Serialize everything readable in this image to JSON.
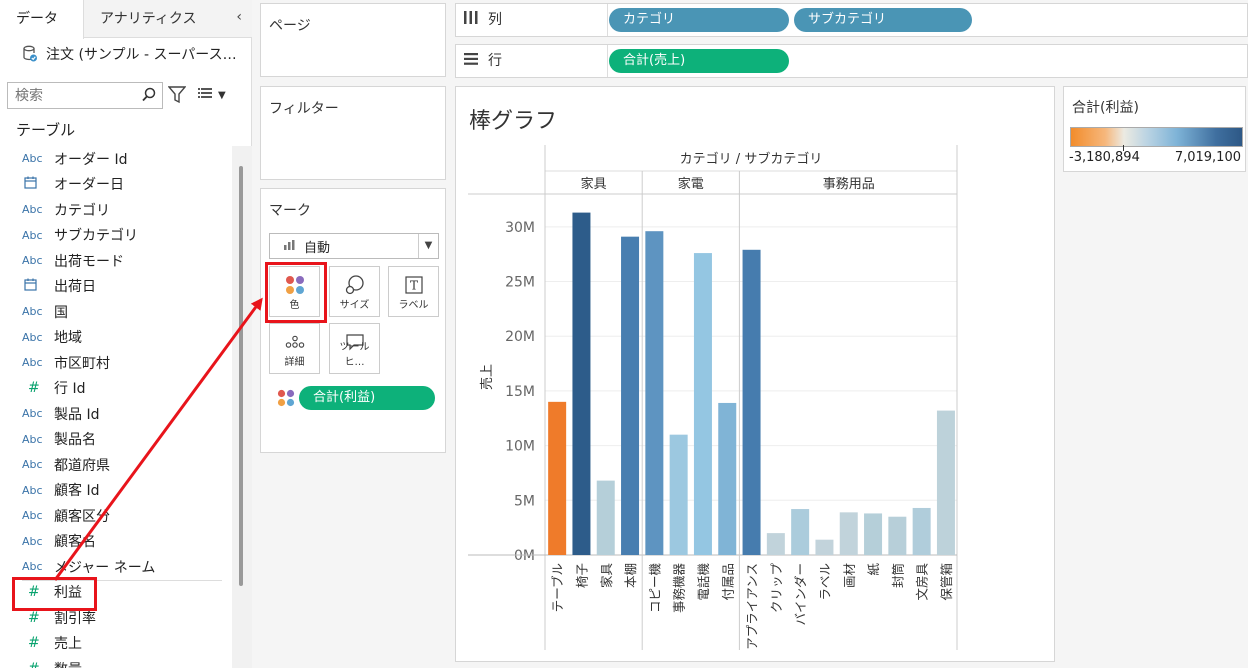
{
  "left_pane": {
    "tabs": [
      "データ",
      "アナリティクス"
    ],
    "collapse_icon": "‹",
    "datasource": "注文 (サンプル - スーパース…",
    "search_placeholder": "検索",
    "section_label": "テーブル",
    "fields": [
      {
        "type": "Abc",
        "name": "オーダー Id"
      },
      {
        "type": "date",
        "name": "オーダー日"
      },
      {
        "type": "Abc",
        "name": "カテゴリ"
      },
      {
        "type": "Abc",
        "name": "サブカテゴリ"
      },
      {
        "type": "Abc",
        "name": "出荷モード"
      },
      {
        "type": "date",
        "name": "出荷日"
      },
      {
        "type": "Abc",
        "name": "国"
      },
      {
        "type": "Abc",
        "name": "地域"
      },
      {
        "type": "Abc",
        "name": "市区町村"
      },
      {
        "type": "#",
        "name": "行 Id"
      },
      {
        "type": "Abc",
        "name": "製品 Id"
      },
      {
        "type": "Abc",
        "name": "製品名"
      },
      {
        "type": "Abc",
        "name": "都道府県"
      },
      {
        "type": "Abc",
        "name": "顧客 Id"
      },
      {
        "type": "Abc",
        "name": "顧客区分"
      },
      {
        "type": "Abc",
        "name": "顧客名"
      },
      {
        "type": "Abc",
        "name": "メジャー ネーム"
      },
      {
        "type": "#",
        "name": "利益"
      },
      {
        "type": "#",
        "name": "割引率"
      },
      {
        "type": "#",
        "name": "売上"
      },
      {
        "type": "#",
        "name": "数量"
      }
    ]
  },
  "cards": {
    "pages": "ページ",
    "filters": "フィルター",
    "marks": "マーク",
    "mark_type": "自動",
    "mark_buttons": [
      "色",
      "サイズ",
      "ラベル",
      "詳細",
      "ツールヒ…"
    ],
    "color_pill": "合計(利益)"
  },
  "shelves": {
    "columns_label": "列",
    "rows_label": "行",
    "column_pills": [
      "カテゴリ",
      "サブカテゴリ"
    ],
    "row_pills": [
      "合計(売上)"
    ]
  },
  "viz": {
    "title": "棒グラフ"
  },
  "legend": {
    "title": "合計(利益)",
    "min": "-3,180,894",
    "max": "7,019,100"
  },
  "colors": {
    "accent_red": "#e8141b",
    "pill_blue": "#4a95b5",
    "pill_green": "#0db17a"
  },
  "chart_data": {
    "type": "bar",
    "title": "棒グラフ",
    "header": "カテゴリ / サブカテゴリ",
    "ylabel": "売上",
    "ylim": [
      0,
      33000000
    ],
    "yticks": [
      0,
      5000000,
      10000000,
      15000000,
      20000000,
      25000000,
      30000000
    ],
    "ytick_labels": [
      "0M",
      "5M",
      "10M",
      "15M",
      "20M",
      "25M",
      "30M"
    ],
    "groups": [
      {
        "name": "家具",
        "categories": [
          "テーブル",
          "椅子",
          "家具",
          "本棚"
        ],
        "values": [
          14000000,
          31300000,
          6800000,
          29100000
        ],
        "profit": [
          -3180894,
          7019100,
          1100000,
          5200000
        ]
      },
      {
        "name": "家電",
        "categories": [
          "コピー機",
          "事務機器",
          "電話機",
          "付属品"
        ],
        "values": [
          29600000,
          11000000,
          27600000,
          13900000
        ],
        "profit": [
          4300000,
          2100000,
          2400000,
          3100000
        ]
      },
      {
        "name": "事務用品",
        "categories": [
          "アプライアンス",
          "クリップ",
          "バインダー",
          "ラベル",
          "画材",
          "紙",
          "封筒",
          "文房具",
          "保管箱"
        ],
        "values": [
          27900000,
          2000000,
          4200000,
          1400000,
          3900000,
          3800000,
          3500000,
          4300000,
          13200000
        ],
        "profit": [
          5300000,
          400000,
          1500000,
          300000,
          400000,
          1100000,
          1000000,
          1300000,
          600000
        ]
      }
    ]
  }
}
